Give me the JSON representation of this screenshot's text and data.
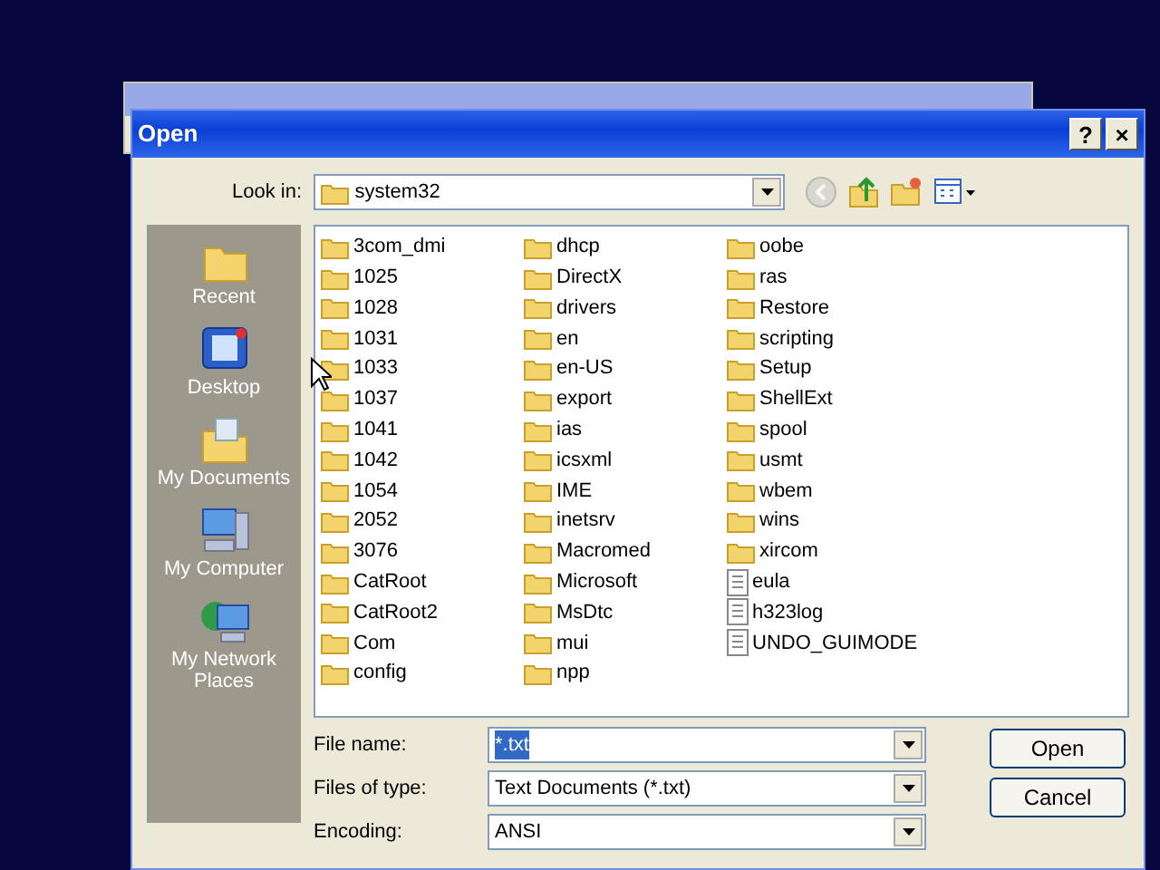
{
  "dialog": {
    "title": "Open",
    "title_buttons": [
      "?",
      "×"
    ]
  },
  "look_in": {
    "label": "Look in:",
    "value": "system32"
  },
  "toolbar": [
    {
      "kind": "back",
      "disabled": true
    },
    {
      "kind": "up",
      "disabled": false
    },
    {
      "kind": "new_folder",
      "disabled": false
    },
    {
      "kind": "views",
      "disabled": false
    }
  ],
  "places": [
    {
      "kind": "recent",
      "label": "Recent"
    },
    {
      "kind": "desktop",
      "label": "Desktop"
    },
    {
      "kind": "documents",
      "label": "My Documents"
    },
    {
      "kind": "computer",
      "label": "My Computer"
    },
    {
      "kind": "network",
      "label": "My Network Places"
    }
  ],
  "files": [
    {
      "name": "3com_dmi",
      "kind": "folder"
    },
    {
      "name": "1025",
      "kind": "folder"
    },
    {
      "name": "1028",
      "kind": "folder"
    },
    {
      "name": "1031",
      "kind": "folder"
    },
    {
      "name": "1033",
      "kind": "folder"
    },
    {
      "name": "1037",
      "kind": "folder"
    },
    {
      "name": "1041",
      "kind": "folder"
    },
    {
      "name": "1042",
      "kind": "folder"
    },
    {
      "name": "1054",
      "kind": "folder"
    },
    {
      "name": "2052",
      "kind": "folder"
    },
    {
      "name": "3076",
      "kind": "folder"
    },
    {
      "name": "CatRoot",
      "kind": "folder"
    },
    {
      "name": "CatRoot2",
      "kind": "folder"
    },
    {
      "name": "Com",
      "kind": "folder"
    },
    {
      "name": "config",
      "kind": "folder"
    },
    {
      "name": "dhcp",
      "kind": "folder"
    },
    {
      "name": "DirectX",
      "kind": "folder"
    },
    {
      "name": "drivers",
      "kind": "folder"
    },
    {
      "name": "en",
      "kind": "folder"
    },
    {
      "name": "en-US",
      "kind": "folder"
    },
    {
      "name": "export",
      "kind": "folder"
    },
    {
      "name": "ias",
      "kind": "folder"
    },
    {
      "name": "icsxml",
      "kind": "folder"
    },
    {
      "name": "IME",
      "kind": "folder"
    },
    {
      "name": "inetsrv",
      "kind": "folder"
    },
    {
      "name": "Macromed",
      "kind": "folder"
    },
    {
      "name": "Microsoft",
      "kind": "folder"
    },
    {
      "name": "MsDtc",
      "kind": "folder"
    },
    {
      "name": "mui",
      "kind": "folder"
    },
    {
      "name": "npp",
      "kind": "folder"
    },
    {
      "name": "oobe",
      "kind": "folder"
    },
    {
      "name": "ras",
      "kind": "folder"
    },
    {
      "name": "Restore",
      "kind": "folder"
    },
    {
      "name": "scripting",
      "kind": "folder"
    },
    {
      "name": "Setup",
      "kind": "folder"
    },
    {
      "name": "ShellExt",
      "kind": "folder"
    },
    {
      "name": "spool",
      "kind": "folder"
    },
    {
      "name": "usmt",
      "kind": "folder"
    },
    {
      "name": "wbem",
      "kind": "folder"
    },
    {
      "name": "wins",
      "kind": "folder"
    },
    {
      "name": "xircom",
      "kind": "folder"
    },
    {
      "name": "eula",
      "kind": "file"
    },
    {
      "name": "h323log",
      "kind": "file"
    },
    {
      "name": "UNDO_GUIMODE",
      "kind": "file"
    }
  ],
  "fields": [
    {
      "label": "File name:",
      "value": "*.txt",
      "selected": true
    },
    {
      "label": "Files of type:",
      "value": "Text Documents (*.txt)",
      "selected": false
    },
    {
      "label": "Encoding:",
      "value": "ANSI",
      "selected": false
    }
  ],
  "buttons": [
    "Open",
    "Cancel"
  ]
}
